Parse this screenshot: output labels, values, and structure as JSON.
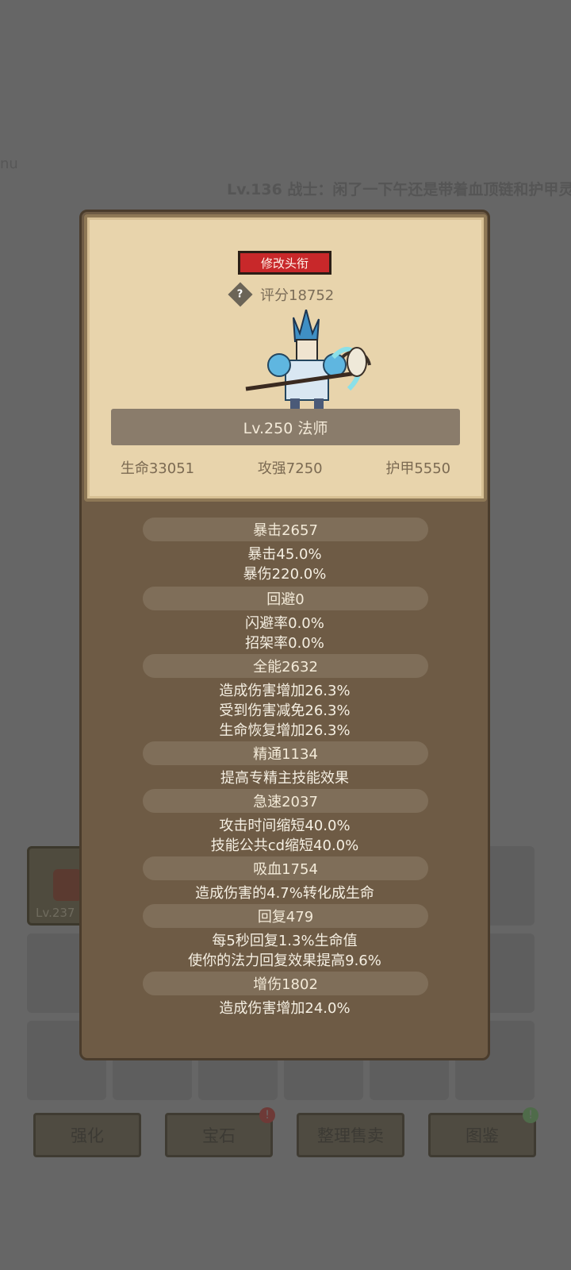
{
  "background": {
    "fragment_text": "nu",
    "chat_text": "Lv.136 战士：闲了一下午还是带着血顶链和护甲灵",
    "item_slot_level": "Lv.237",
    "buttons": [
      {
        "label": "强化",
        "badge": ""
      },
      {
        "label": "宝石",
        "badge": "!"
      },
      {
        "label": "整理售卖",
        "badge": ""
      },
      {
        "label": "图鉴",
        "badge": "!"
      }
    ]
  },
  "panel": {
    "edit_title_label": "修改头衔",
    "score_label": "评分18752",
    "help_icon_glyph": "?",
    "level_class": "Lv.250 法师",
    "stats": {
      "hp": "生命33051",
      "attack": "攻强7250",
      "armor": "护甲5550"
    },
    "sections": [
      {
        "header": "暴击2657",
        "lines": [
          "暴击45.0%",
          "暴伤220.0%"
        ]
      },
      {
        "header": "回避0",
        "lines": [
          "闪避率0.0%",
          "招架率0.0%"
        ]
      },
      {
        "header": "全能2632",
        "lines": [
          "造成伤害增加26.3%",
          "受到伤害减免26.3%",
          "生命恢复增加26.3%"
        ]
      },
      {
        "header": "精通1134",
        "lines": [
          "提高专精主技能效果"
        ]
      },
      {
        "header": "急速2037",
        "lines": [
          "攻击时间缩短40.0%",
          "技能公共cd缩短40.0%"
        ]
      },
      {
        "header": "吸血1754",
        "lines": [
          "造成伤害的4.7%转化成生命"
        ]
      },
      {
        "header": "回复479",
        "lines": [
          "每5秒回复1.3%生命值",
          "使你的法力回复效果提高9.6%"
        ]
      },
      {
        "header": "增伤1802",
        "lines": [
          "造成伤害增加24.0%"
        ]
      }
    ]
  }
}
